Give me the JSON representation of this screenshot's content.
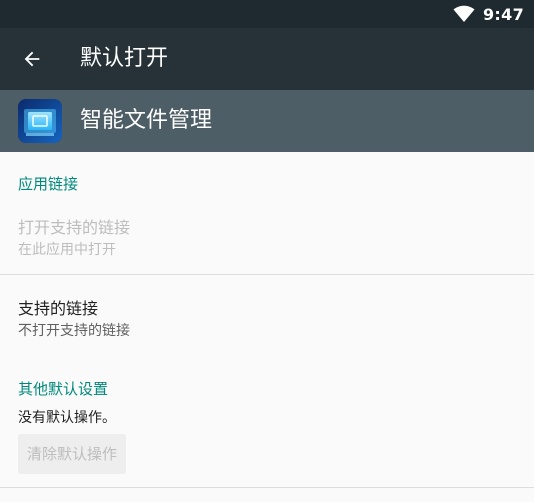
{
  "status_bar": {
    "time": "9:47",
    "wifi_icon": "wifi-icon"
  },
  "toolbar": {
    "back_icon": "arrow-back-icon",
    "title": "默认打开"
  },
  "app_header": {
    "app_icon": "file-manager-app-icon",
    "app_name": "智能文件管理"
  },
  "app_links": {
    "section_title": "应用链接",
    "open_supported_links": {
      "title": "打开支持的链接",
      "summary": "在此应用中打开",
      "enabled": false
    },
    "supported_links": {
      "title": "支持的链接",
      "summary": "不打开支持的链接"
    }
  },
  "other_defaults": {
    "section_title": "其他默认设置",
    "status": "没有默认操作。",
    "clear_button_label": "清除默认操作"
  },
  "colors": {
    "status_bar": "#1f2a30",
    "toolbar": "#263238",
    "app_header": "#4d5e66",
    "accent": "#00897b",
    "background": "#fafafa"
  }
}
